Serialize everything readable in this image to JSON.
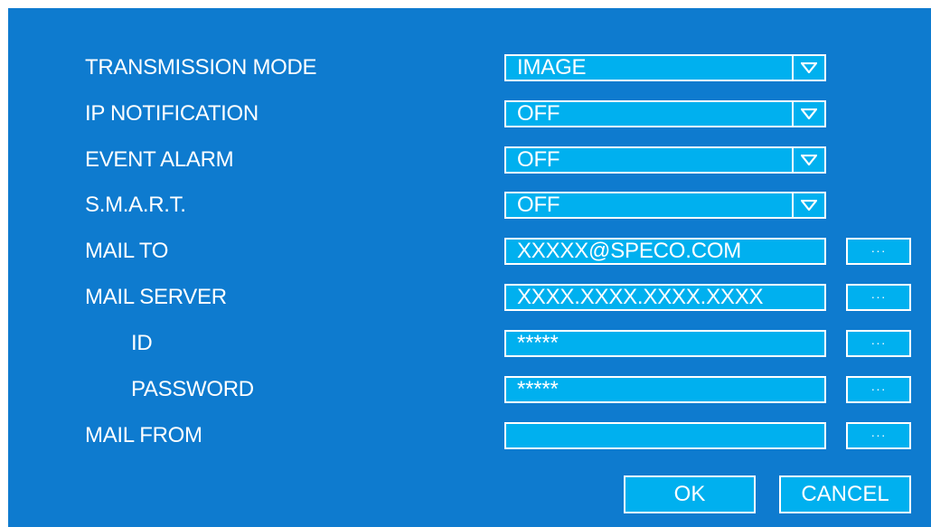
{
  "rows": [
    {
      "label": "TRANSMISSION MODE",
      "value": "IMAGE",
      "kind": "select"
    },
    {
      "label": "IP NOTIFICATION",
      "value": "OFF",
      "kind": "select"
    },
    {
      "label": "EVENT ALARM",
      "value": "OFF",
      "kind": "select"
    },
    {
      "label": "S.M.A.R.T.",
      "value": "OFF",
      "kind": "select"
    },
    {
      "label": "MAIL TO",
      "value": "XXXXX@SPECO.COM",
      "kind": "text"
    },
    {
      "label": "MAIL SERVER",
      "value": "XXXX.XXXX.XXXX.XXXX",
      "kind": "text"
    },
    {
      "label": "ID",
      "value": "*****",
      "kind": "text"
    },
    {
      "label": "PASSWORD",
      "value": "*****",
      "kind": "text"
    },
    {
      "label": "MAIL FROM",
      "value": "",
      "kind": "text"
    }
  ],
  "browse_label": "···",
  "buttons": {
    "ok": "OK",
    "cancel": "CANCEL"
  },
  "colors": {
    "panel": "#0e7bcf",
    "field": "#00b0ef",
    "border": "#ffffff",
    "text": "#ffffff"
  },
  "icons": {
    "dropdown": "chevron-down-icon",
    "browse": "ellipsis-icon"
  }
}
